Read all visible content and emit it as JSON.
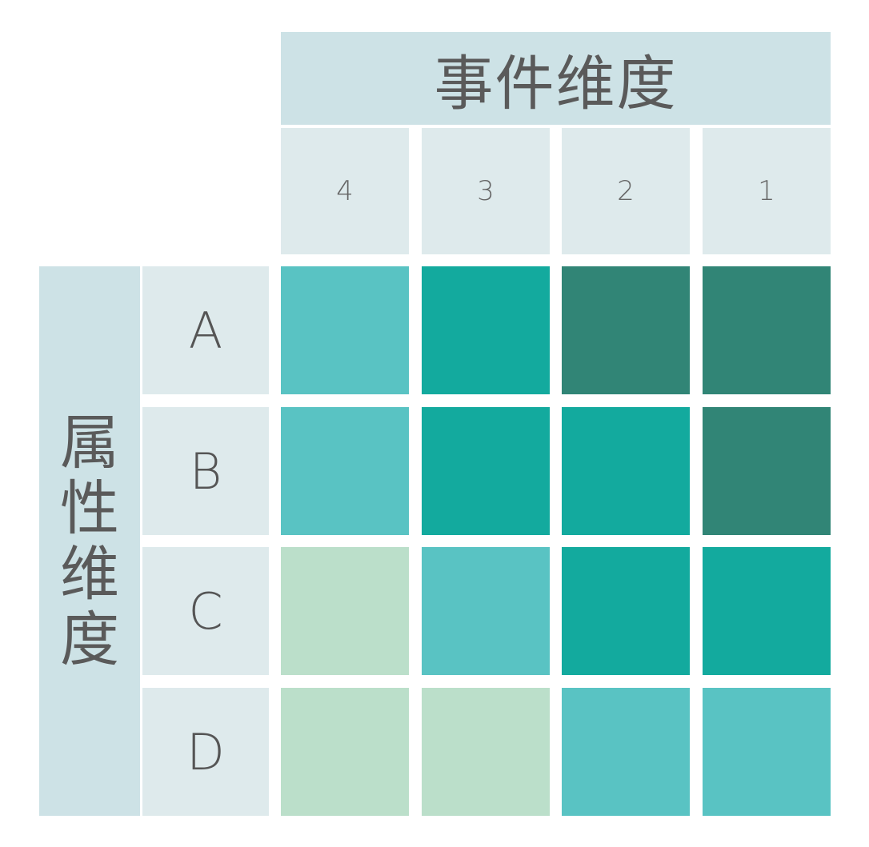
{
  "event_dimension": {
    "label": "事件维度"
  },
  "attribute_dimension": {
    "chars": [
      "属",
      "性",
      "维",
      "度"
    ]
  },
  "chart_data": {
    "type": "heatmap",
    "x": [
      "4",
      "3",
      "2",
      "1"
    ],
    "y": [
      "A",
      "B",
      "C",
      "D"
    ],
    "levels": {
      "1": "#bbdfca",
      "2": "#59c3c3",
      "3": "#13aa9e",
      "4": "#318576"
    },
    "values": [
      [
        2,
        3,
        4,
        4
      ],
      [
        2,
        3,
        3,
        4
      ],
      [
        1,
        2,
        3,
        3
      ],
      [
        1,
        1,
        2,
        2
      ]
    ]
  }
}
